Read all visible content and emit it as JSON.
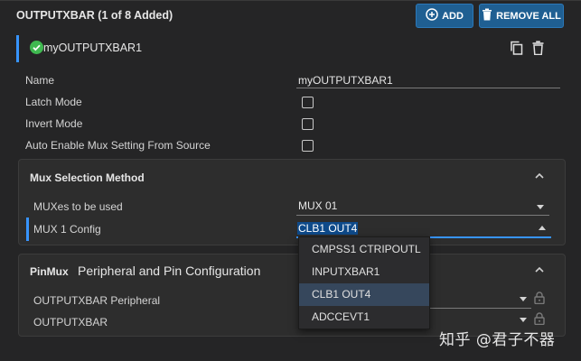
{
  "header": {
    "title": "OUTPUTXBAR (1 of 8 Added)",
    "add_label": "ADD",
    "remove_all_label": "REMOVE ALL"
  },
  "instance": {
    "name": "myOUTPUTXBAR1"
  },
  "fields": {
    "name_label": "Name",
    "name_value": "myOUTPUTXBAR1",
    "latch_label": "Latch Mode",
    "latch_checked": false,
    "invert_label": "Invert Mode",
    "invert_checked": false,
    "auto_enable_label": "Auto Enable Mux Setting From Source",
    "auto_enable_checked": false
  },
  "mux_selection": {
    "title": "Mux Selection Method",
    "muxes_label": "MUXes to be used",
    "muxes_value": "MUX 01",
    "mux1_label": "MUX 1 Config",
    "mux1_value": "CLB1 OUT4"
  },
  "pinmux": {
    "badge": "PinMux",
    "title": "Peripheral and Pin Configuration",
    "peripheral_label": "OUTPUTXBAR Peripheral",
    "pin_label": "OUTPUTXBAR"
  },
  "dropdown": {
    "options": [
      "CMPSS1 CTRIPOUTL",
      "INPUTXBAR1",
      "CLB1 OUT4",
      "ADCCEVT1"
    ],
    "selected": "CLB1 OUT4"
  },
  "watermark": "知乎 @君子不器",
  "colors": {
    "background": "#252526",
    "button": "#1f5f92",
    "accent": "#3794ff",
    "check": "#3fb950",
    "selection": "#0e4a8a"
  }
}
